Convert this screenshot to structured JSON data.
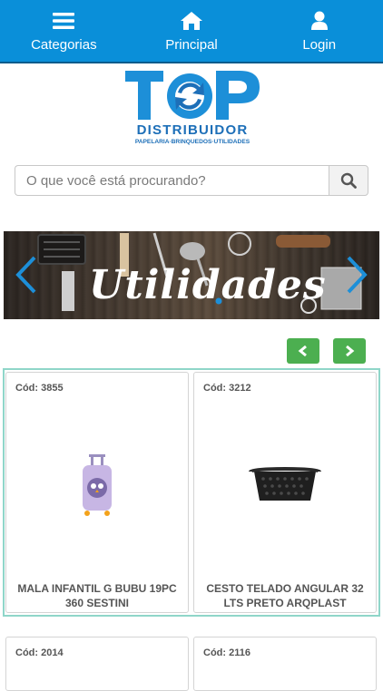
{
  "nav": {
    "categories": "Categorias",
    "home": "Principal",
    "login": "Login"
  },
  "logo": {
    "word": "TOP",
    "sub": "DISTRIBUIDOR",
    "tagline": "PAPELARIA·BRINQUEDOS·UTILIDADES"
  },
  "search": {
    "placeholder": "O que você está procurando?"
  },
  "banner": {
    "text": "Utilidades"
  },
  "products": [
    {
      "code": "Cód: 3855",
      "name": "MALA INFANTIL G BUBU 19PC 360 SESTINI"
    },
    {
      "code": "Cód: 3212",
      "name": "CESTO TELADO ANGULAR 32 LTS PRETO ARQPLAST"
    },
    {
      "code": "Cód: 2014",
      "name": ""
    },
    {
      "code": "Cód: 2116",
      "name": ""
    }
  ],
  "colors": {
    "brand_blue": "#0a8fd9",
    "pager_green": "#4caf50",
    "grid_border": "#8fd6c9"
  },
  "icons": {
    "categories": "hamburger-icon",
    "home": "home-icon",
    "login": "user-icon",
    "search": "search-icon"
  }
}
